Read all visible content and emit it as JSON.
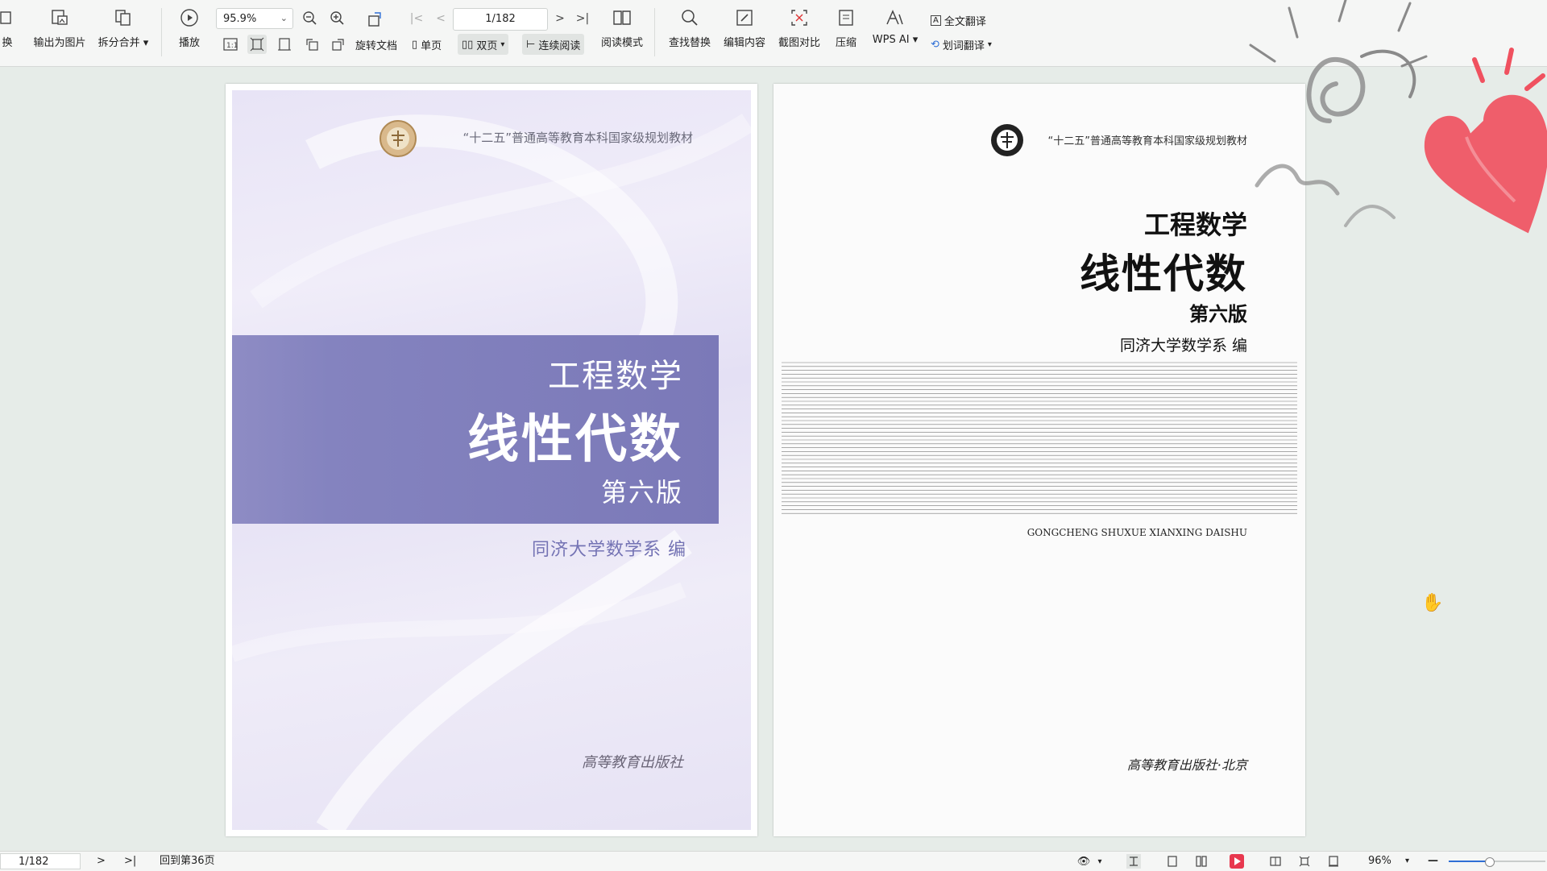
{
  "toolbar": {
    "cut_label": "换",
    "export_image_label": "输出为图片",
    "split_merge_label": "拆分合并",
    "play_label": "播放",
    "zoom_value": "95.9%",
    "page_value": "1/182",
    "rotate_label": "旋转文档",
    "single_page_label": "单页",
    "double_page_label": "双页",
    "continuous_label": "连续阅读",
    "read_mode_label": "阅读模式",
    "find_replace_label": "查找替换",
    "edit_content_label": "编辑内容",
    "screenshot_compare_label": "截图对比",
    "compress_label": "压缩",
    "wps_ai_label": "WPS AI",
    "full_translate_label": "全文翻译",
    "word_translate_label": "划词翻译"
  },
  "cover": {
    "series": "“十二五”普通高等教育本科国家级规划教材",
    "title_small": "工程数学",
    "title_big": "线性代数",
    "edition": "第六版",
    "author": "同济大学数学系 编",
    "publisher": "高等教育出版社"
  },
  "title_page": {
    "series": "“十二五”普通高等教育本科国家级规划教材",
    "title_small": "工程数学",
    "title_big": "线性代数",
    "edition": "第六版",
    "author": "同济大学数学系 编",
    "pinyin": "GONGCHENG SHUXUE XIANXING DAISHU",
    "publisher": "高等教育出版社·北京"
  },
  "statusbar": {
    "page_value": "1/182",
    "back_to_page": "回到第36页",
    "zoom_value": "96%",
    "zoom_fraction": 0.42
  },
  "colors": {
    "band": "#7b79b8",
    "author_purple": "#7473b4",
    "heart": "#f0515f",
    "accent_blue": "#2f6fd6"
  }
}
